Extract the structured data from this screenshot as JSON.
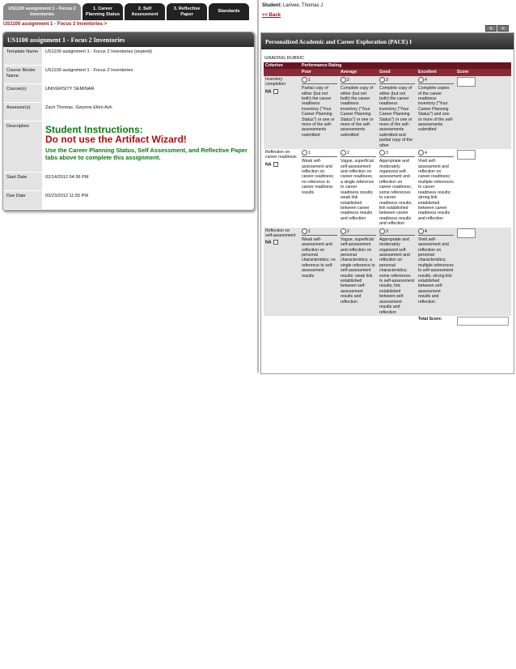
{
  "tabs": [
    {
      "label": "US1100 assignment 1 - Focus 2 Inventories",
      "active": true
    },
    {
      "label": "1. Career Planning Status",
      "active": false
    },
    {
      "label": "2. Self Assessment",
      "active": false
    },
    {
      "label": "3. Reflective Paper",
      "active": false
    },
    {
      "label": "Standards",
      "active": false
    }
  ],
  "breadcrumb": "US1100 assignment 1 - Focus 2 Inventories >",
  "card": {
    "title": "US1100 assignment 1 - Focus 2 Inventories",
    "rows": [
      {
        "label": "Template Name",
        "value": "US1100 assignment 1 - Focus 2 Inventories (expired)"
      },
      {
        "label": "Course Binder Name",
        "value": "US1100 assignment 1 - Focus 2 Inventories"
      },
      {
        "label": "Course(s)",
        "value": "UNIVERSITY SEMINAR"
      },
      {
        "label": "Assessor(s)",
        "value": "Zach Thomas, Gwynne Ellen Ash"
      }
    ],
    "description_label": "Description",
    "instr_heading": "Student Instructions:",
    "instr_warning": "Do not use the Artifact Wizard!",
    "instr_body": "Use the Career Planning Status, Self Assessment, and Reflective Paper tabs above to complete this assignment.",
    "start_label": "Start Date",
    "start_value": "02/14/2012 04:36 PM",
    "due_label": "Due Date",
    "due_value": "03/23/2012 11:55 PM"
  },
  "student": {
    "label": "Student:",
    "name": "Larivee, Thomas J"
  },
  "back_link": "<< Back",
  "pace": {
    "title": "Personalized Academic and Career Exploration (PACE) I",
    "rubric_title": "GRADING RUBRIC",
    "col_criterion": "Criterion",
    "col_performance": "Performance Rating",
    "levels": [
      "Poor",
      "Average",
      "Good",
      "Excellent"
    ],
    "col_score": "Score",
    "na_label": "NA",
    "criteria": [
      {
        "name": "Inventory completion",
        "options": [
          "1",
          "2",
          "3",
          "4"
        ],
        "descriptions": [
          "Partial copy of either (but not both) the career readiness inventory (\"Your Career Planning Status\") or one or more of the self-assessments submitted",
          "Complete copy of either (but not both) the career readiness inventory (\"Your Career Planning Status\") or one or more of the self-assessments submitted",
          "Complete copy of either (but not both) the career readiness inventory (\"Your Career Planning Status\") or one or more of the self-assessments submitted and partial copy of the other",
          "Complete copies of the career readiness inventory (\"Your Career Planning Status\") and one or more of the self-assessments submitted"
        ]
      },
      {
        "name": "Reflection on career readiness",
        "options": [
          "1",
          "2",
          "3",
          "4"
        ],
        "descriptions": [
          "Weak self-assessment and reflection on career readiness; no reference to career readiness results",
          "Vague, superficial self-assessment and reflection on career readiness; a single reference to career readiness results; weak link established between career readiness results and reflection",
          "Appropriate and moderately organized self-assessment and reflection on career readiness; some references to career readiness results; link established between career readiness results and reflection",
          "Vivid self-assessment and reflection on career readiness; multiple references to career readiness results; strong link established between career readiness results and reflection"
        ]
      },
      {
        "name": "Reflection on self-assessment",
        "options": [
          "1",
          "2",
          "3",
          "4"
        ],
        "descriptions": [
          "Weak self-assessment and reflection on personal characteristics; no reference to self-assessment results",
          "Vague, superficial self-assessment and reflection on personal characteristics; a single reference to self-assessment results; weak link established between self-assessment results and reflection",
          "Appropriate and moderately organized self-assessment and reflection on personal characteristics; some references to self-assessment results; link established between self-assessment results and reflection",
          "Vivid self-assessment and reflection on personal characteristics; multiple references to self-assessment results; strong link established between self-assessment results and reflection"
        ]
      }
    ],
    "total_label": "Total Score:"
  },
  "colors": {
    "header_dark": "#2c2c2c",
    "rubric_maroon": "#6a1420",
    "green": "#0a7a12",
    "red": "#b01010"
  }
}
